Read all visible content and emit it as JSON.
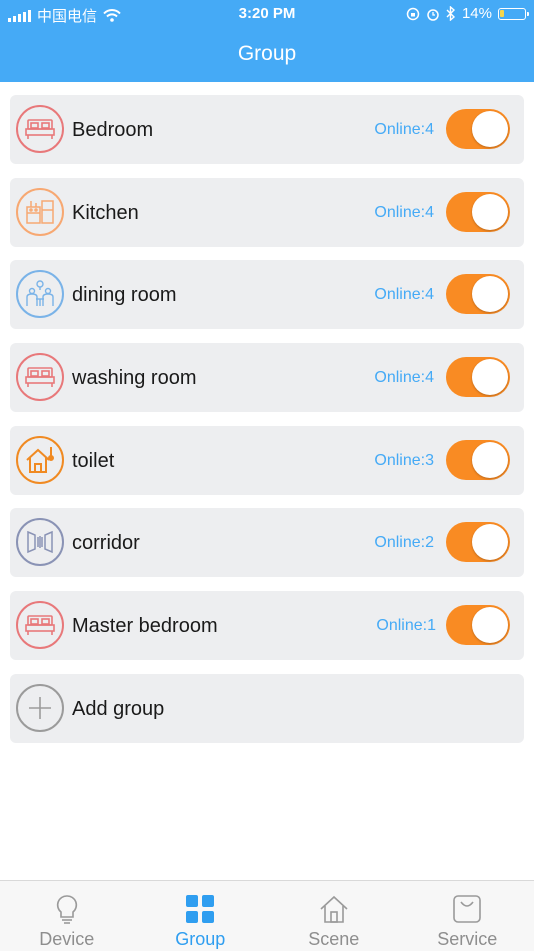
{
  "status_bar": {
    "carrier": "中国电信",
    "time": "3:20 PM",
    "battery": "14%",
    "battery_level": 0.14
  },
  "header": {
    "title": "Group"
  },
  "groups": [
    {
      "name": "Bedroom",
      "status": "Online:4",
      "icon": "bed-icon",
      "color": "#e8787a",
      "enabled": true
    },
    {
      "name": "Kitchen",
      "status": "Online:4",
      "icon": "kitchen-icon",
      "color": "#f7a872",
      "enabled": true
    },
    {
      "name": "dining room",
      "status": "Online:4",
      "icon": "dining-icon",
      "color": "#7ab3e8",
      "enabled": true
    },
    {
      "name": "washing room",
      "status": "Online:4",
      "icon": "bed-icon",
      "color": "#e8787a",
      "enabled": true
    },
    {
      "name": "toilet",
      "status": "Online:3",
      "icon": "house-icon",
      "color": "#f08a22",
      "enabled": true
    },
    {
      "name": "corridor",
      "status": "Online:2",
      "icon": "corridor-icon",
      "color": "#8a93b5",
      "enabled": true
    },
    {
      "name": "Master bedroom",
      "status": "Online:1",
      "icon": "bed-icon",
      "color": "#e8787a",
      "enabled": true
    }
  ],
  "add_group": {
    "label": "Add group",
    "icon": "plus-icon"
  },
  "tabs": [
    {
      "label": "Device",
      "icon": "bulb-icon",
      "active": false
    },
    {
      "label": "Group",
      "icon": "grid-icon",
      "active": true
    },
    {
      "label": "Scene",
      "icon": "home-icon",
      "active": false
    },
    {
      "label": "Service",
      "icon": "bag-icon",
      "active": false
    }
  ],
  "colors": {
    "header": "#45aaf6",
    "accent_orange": "#f98b23",
    "online_text": "#45aaf6",
    "row_bg": "#edeef0",
    "tab_active": "#2f9ef0"
  }
}
